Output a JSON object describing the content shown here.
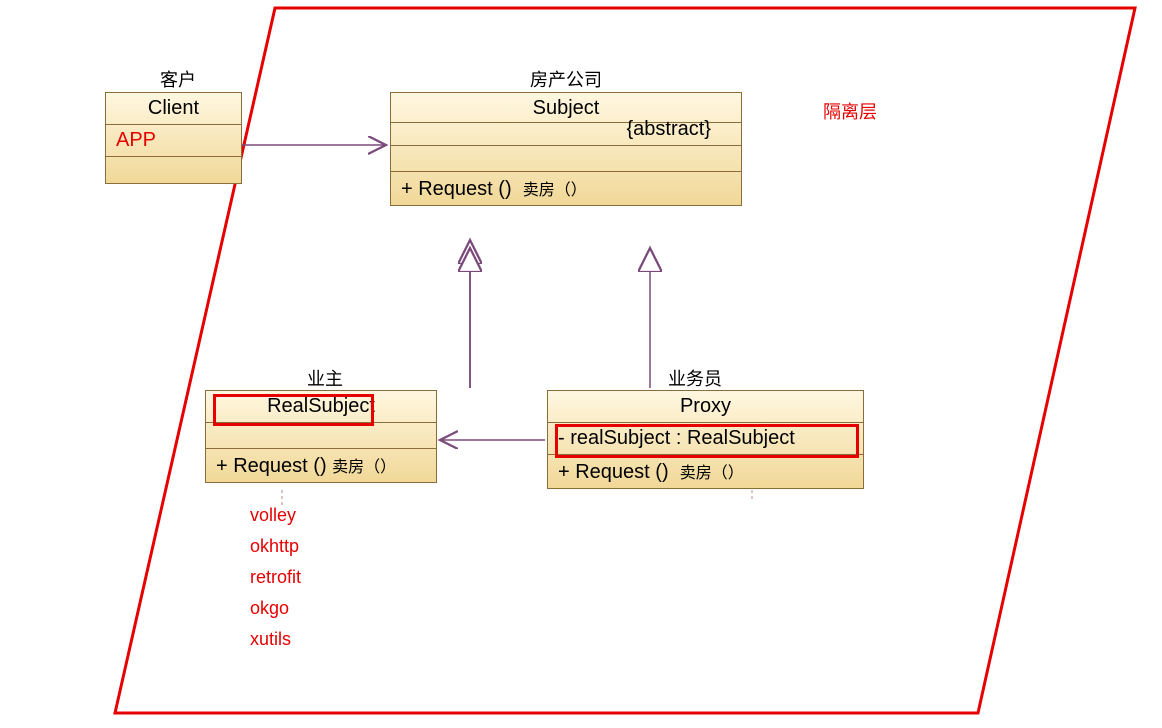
{
  "isolation_layer_label": "隔离层",
  "client": {
    "role": "客户",
    "name": "Client",
    "annotation": "APP"
  },
  "subject": {
    "role": "房产公司",
    "name": "Subject",
    "stereotype": "{abstract}",
    "method": "+  Request ()",
    "method_cn": "卖房（）"
  },
  "real_subject": {
    "role": "业主",
    "name": "RealSubject",
    "method": "+  Request ()",
    "method_cn": "卖房（）",
    "libs": [
      "volley",
      "okhttp",
      "retrofit",
      "okgo",
      "xutils"
    ]
  },
  "proxy": {
    "role": "业务员",
    "name": "Proxy",
    "field": "-  realSubject   : RealSubject",
    "method": "+  Request ()",
    "method_cn": "卖房（）"
  }
}
